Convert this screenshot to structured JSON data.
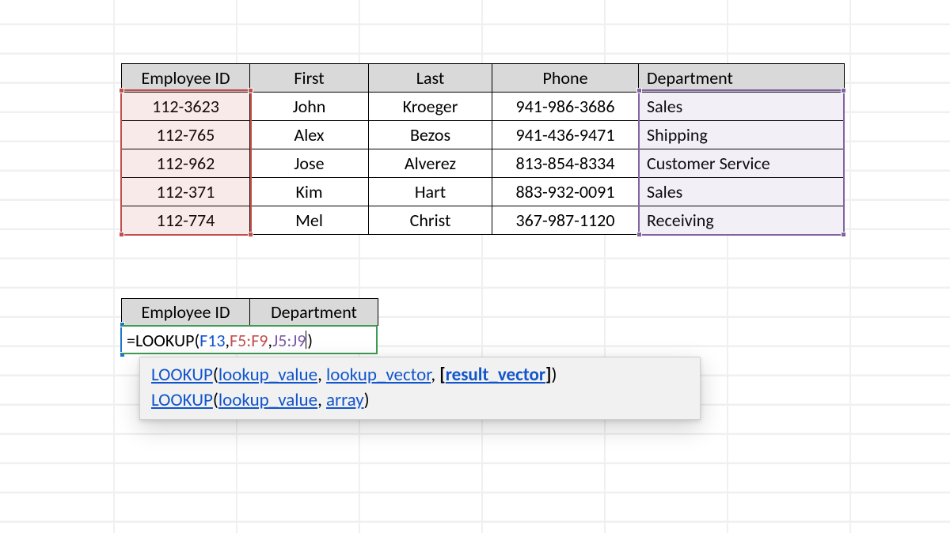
{
  "table": {
    "headers": [
      "Employee ID",
      "First",
      "Last",
      "Phone",
      "Department"
    ],
    "rows": [
      {
        "id": "112-3623",
        "first": "John",
        "last": "Kroeger",
        "phone": "941-986-3686",
        "dept": "Sales"
      },
      {
        "id": "112-765",
        "first": "Alex",
        "last": "Bezos",
        "phone": "941-436-9471",
        "dept": "Shipping"
      },
      {
        "id": "112-962",
        "first": "Jose",
        "last": "Alverez",
        "phone": "813-854-8334",
        "dept": "Customer Service"
      },
      {
        "id": "112-371",
        "first": "Kim",
        "last": "Hart",
        "phone": "883-932-0091",
        "dept": "Sales"
      },
      {
        "id": "112-774",
        "first": "Mel",
        "last": "Christ",
        "phone": "367-987-1120",
        "dept": "Receiving"
      }
    ]
  },
  "lookup_table": {
    "headers": [
      "Employee ID",
      "Department"
    ]
  },
  "formula": {
    "prefix": "=LOOKUP(",
    "arg1": "F13",
    "sep1": ",",
    "arg2": "F5:F9",
    "sep2": ",",
    "arg3": "J5:J9",
    "suffix": ")"
  },
  "tooltip": {
    "line1": {
      "fn": "LOOKUP",
      "open": "(",
      "a1": "lookup_value",
      "c1": ", ",
      "a2": "lookup_vector",
      "c2": ", ",
      "a3_open": "[",
      "a3": "result_vector",
      "a3_close": "]",
      "close": ")"
    },
    "line2": {
      "fn": "LOOKUP",
      "open": "(",
      "a1": "lookup_value",
      "c1": ", ",
      "a2": "array",
      "close": ")"
    }
  },
  "ranges": {
    "lookup_value_ref": "F13",
    "lookup_vector_ref": "F5:F9",
    "result_vector_ref": "J5:J9"
  }
}
